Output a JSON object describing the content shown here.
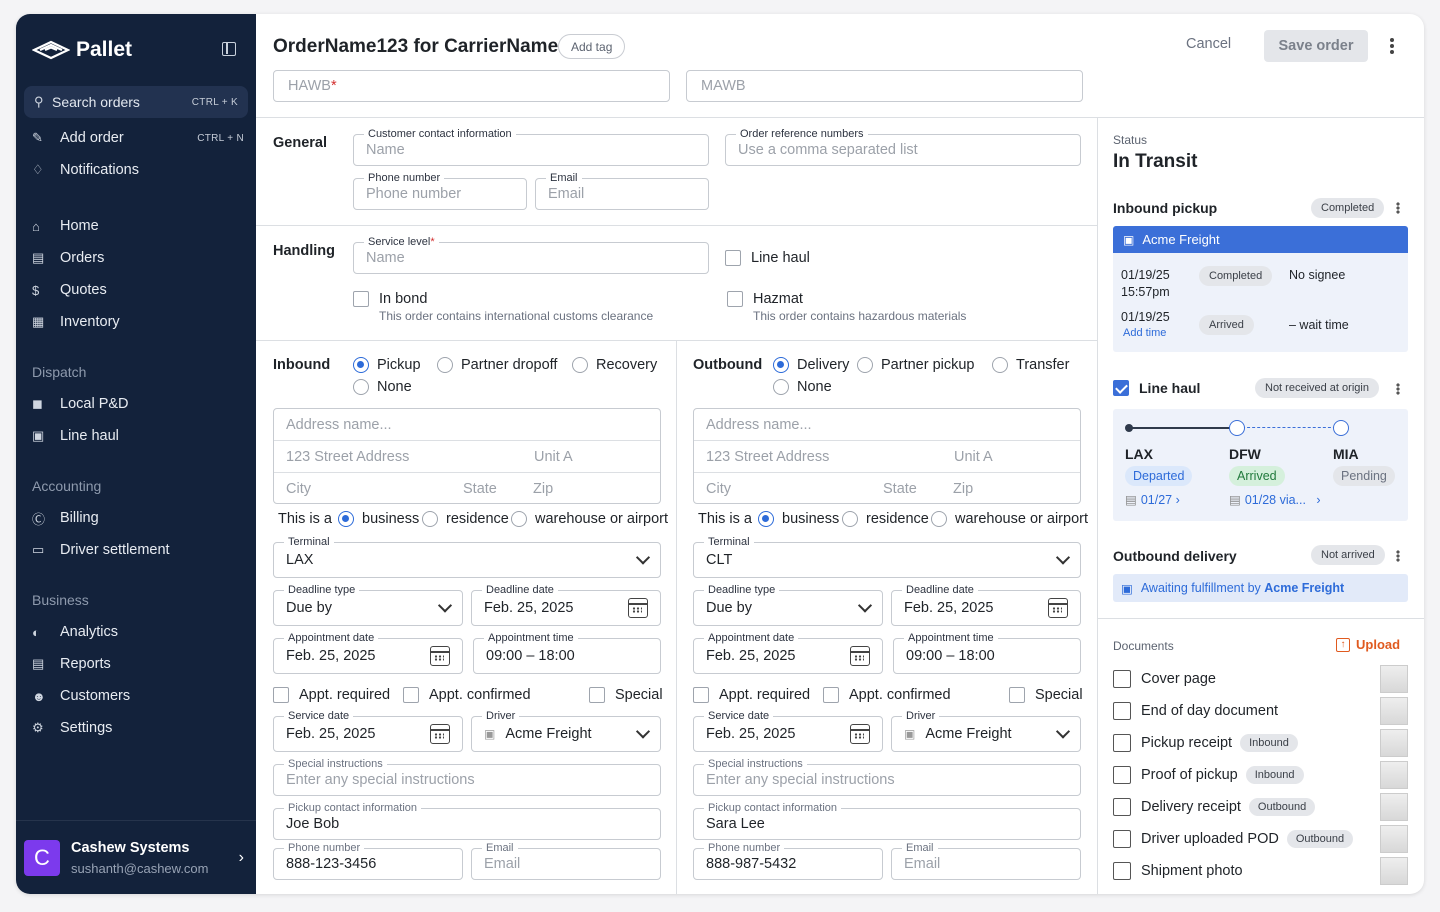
{
  "sidebar": {
    "logo": "Pallet",
    "search": {
      "label": "Search orders",
      "shortcut": "CTRL + K"
    },
    "add_order": {
      "label": "Add order",
      "shortcut": "CTRL + N"
    },
    "notifications": "Notifications",
    "nav": [
      "Home",
      "Orders",
      "Quotes",
      "Inventory"
    ],
    "dispatch": {
      "title": "Dispatch",
      "items": [
        "Local P&D",
        "Line haul"
      ]
    },
    "accounting": {
      "title": "Accounting",
      "items": [
        "Billing",
        "Driver settlement"
      ]
    },
    "business": {
      "title": "Business",
      "items": [
        "Analytics",
        "Reports",
        "Customers",
        "Settings"
      ]
    },
    "user": {
      "initial": "C",
      "name": "Cashew Systems",
      "email": "sushanth@cashew.com"
    }
  },
  "header": {
    "title": "OrderName123 for CarrierName",
    "add_tag": "Add tag",
    "cancel": "Cancel",
    "save": "Save order",
    "hawb_placeholder": "HAWB",
    "mawb_placeholder": "MAWB"
  },
  "general": {
    "title": "General",
    "contact_label": "Customer contact information",
    "contact_placeholder": "Name",
    "order_ref_label": "Order reference numbers",
    "order_ref_placeholder": "Use a comma separated list",
    "phone_label": "Phone number",
    "phone_placeholder": "Phone number",
    "email_label": "Email",
    "email_placeholder": "Email"
  },
  "handling": {
    "title": "Handling",
    "service_label": "Service level",
    "service_placeholder": "Name",
    "line_haul": "Line haul",
    "in_bond": "In bond",
    "in_bond_sub": "This order contains international customs clearance",
    "hazmat": "Hazmat",
    "hazmat_sub": "This order contains hazardous materials"
  },
  "inbound": {
    "title": "Inbound",
    "options": [
      "Pickup",
      "Partner dropoff",
      "Recovery",
      "None"
    ],
    "address_name": "Address name...",
    "street": "123 Street Address",
    "unit": "Unit A",
    "city": "City",
    "state": "State",
    "zip": "Zip",
    "this_is_a": "This is a",
    "loc_types": [
      "business",
      "residence",
      "warehouse or airport"
    ],
    "terminal_label": "Terminal",
    "terminal": "LAX",
    "deadline_type_label": "Deadline type",
    "deadline_type": "Due by",
    "deadline_date_label": "Deadline date",
    "deadline_date": "Feb. 25, 2025",
    "appt_date_label": "Appointment date",
    "appt_date": "Feb. 25, 2025",
    "appt_time_label": "Appointment time",
    "appt_time": "09:00 – 18:00",
    "appt_required": "Appt. required",
    "appt_confirmed": "Appt. confirmed",
    "special": "Special",
    "service_date_label": "Service date",
    "service_date": "Feb. 25, 2025",
    "driver_label": "Driver",
    "driver": "Acme Freight",
    "special_instr_label": "Special instructions",
    "special_instr_placeholder": "Enter any special instructions",
    "contact_label": "Pickup contact information",
    "contact": "Joe Bob",
    "phone_label": "Phone number",
    "phone": "888-123-3456",
    "email_label": "Email",
    "email_placeholder": "Email"
  },
  "outbound": {
    "title": "Outbound",
    "options": [
      "Delivery",
      "Partner pickup",
      "Transfer",
      "None"
    ],
    "address_name": "Address name...",
    "street": "123 Street Address",
    "unit": "Unit A",
    "city": "City",
    "state": "State",
    "zip": "Zip",
    "this_is_a": "This is a",
    "loc_types": [
      "business",
      "residence",
      "warehouse or airport"
    ],
    "terminal_label": "Terminal",
    "terminal": "CLT",
    "deadline_type_label": "Deadline type",
    "deadline_type": "Due by",
    "deadline_date_label": "Deadline date",
    "deadline_date": "Feb. 25, 2025",
    "appt_date_label": "Appointment date",
    "appt_date": "Feb. 25, 2025",
    "appt_time_label": "Appointment time",
    "appt_time": "09:00 – 18:00",
    "appt_required": "Appt. required",
    "appt_confirmed": "Appt. confirmed",
    "special": "Special",
    "service_date_label": "Service date",
    "service_date": "Feb. 25, 2025",
    "driver_label": "Driver",
    "driver": "Acme Freight",
    "special_instr_label": "Special instructions",
    "special_instr_placeholder": "Enter any special instructions",
    "contact_label": "Pickup contact information",
    "contact": "Sara Lee",
    "phone_label": "Phone number",
    "phone": "888-987-5432",
    "email_label": "Email",
    "email_placeholder": "Email"
  },
  "status": {
    "label": "Status",
    "value": "In Transit",
    "inbound_pickup": {
      "title": "Inbound pickup",
      "badge": "Completed",
      "carrier": "Acme Freight",
      "row1_date": "01/19/25",
      "row1_time": "15:57pm",
      "row1_badge": "Completed",
      "row1_note": "No signee",
      "row2_date": "01/19/25",
      "row2_link": "Add time",
      "row2_badge": "Arrived",
      "row2_note": "– wait time"
    },
    "line_haul": {
      "title": "Line haul",
      "badge": "Not received at origin",
      "stops": [
        {
          "code": "LAX",
          "status": "Departed",
          "date": "01/27 ›"
        },
        {
          "code": "DFW",
          "status": "Arrived",
          "date": "01/28 via...   ›"
        },
        {
          "code": "MIA",
          "status": "Pending",
          "date": ""
        }
      ]
    },
    "outbound_delivery": {
      "title": "Outbound delivery",
      "badge": "Not arrived",
      "note_prefix": "Awaiting fulfillment by ",
      "note_carrier": "Acme Freight"
    }
  },
  "documents": {
    "title": "Documents",
    "upload": "Upload",
    "items": [
      {
        "name": "Cover page",
        "tag": ""
      },
      {
        "name": "End of day document",
        "tag": ""
      },
      {
        "name": "Pickup receipt",
        "tag": "Inbound"
      },
      {
        "name": "Proof of pickup",
        "tag": "Inbound"
      },
      {
        "name": "Delivery receipt",
        "tag": "Outbound"
      },
      {
        "name": "Driver uploaded POD",
        "tag": "Outbound"
      },
      {
        "name": "Shipment photo",
        "tag": ""
      }
    ]
  },
  "colors": {
    "sidebar": "#13223b",
    "accent": "#2d6bd9",
    "carrier_bar": "#3b6fd8"
  }
}
